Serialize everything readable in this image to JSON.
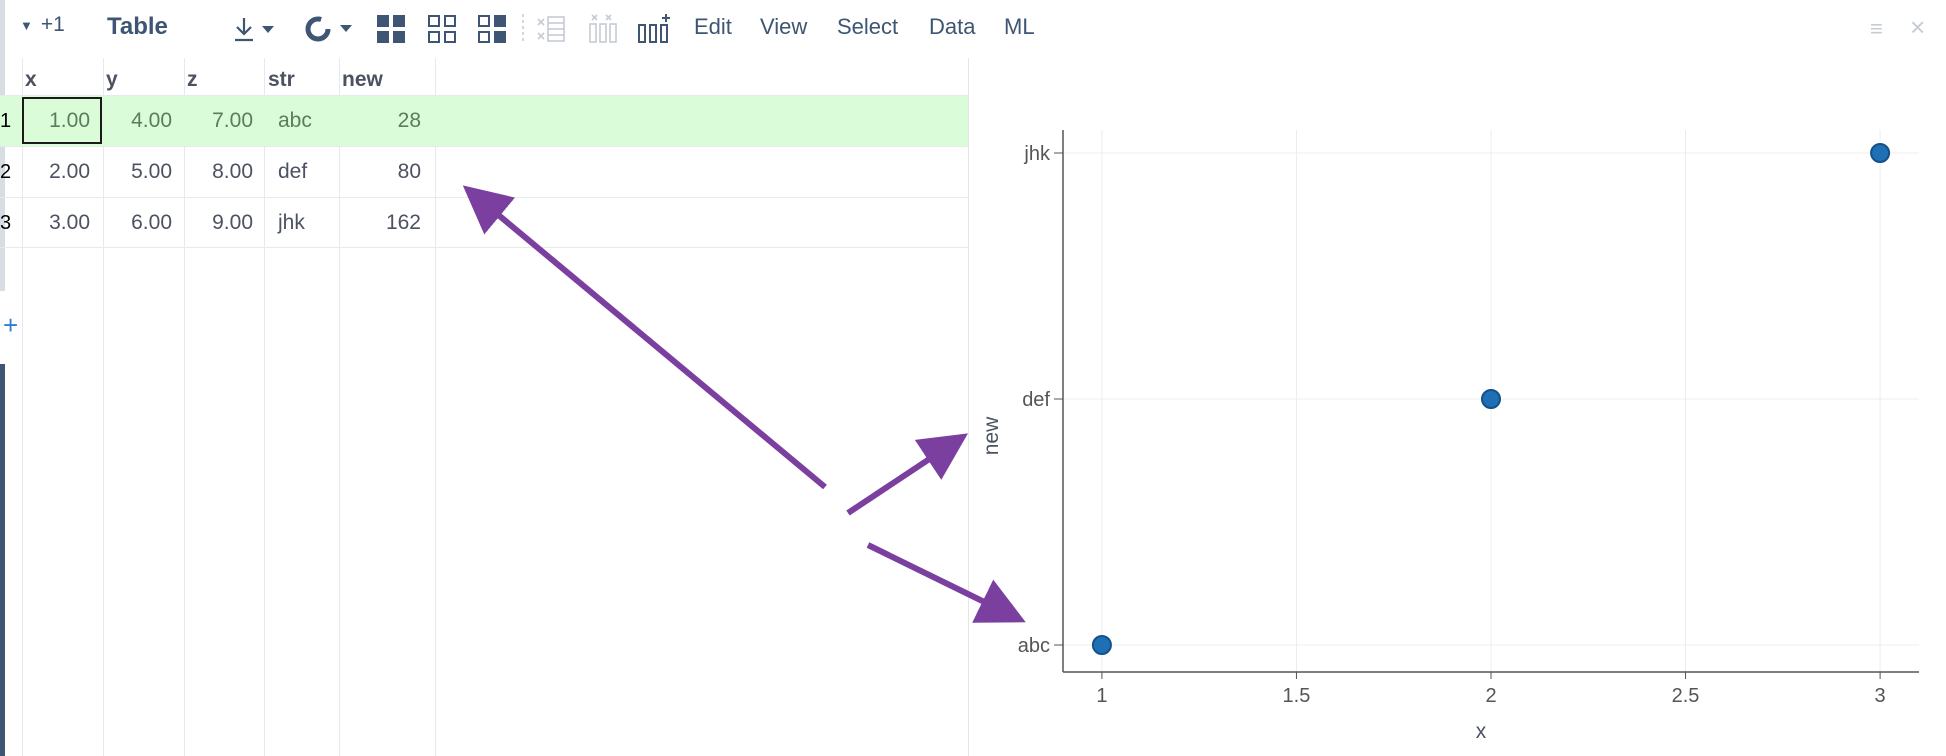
{
  "toolbar": {
    "count_label": "+1",
    "title": "Table",
    "menus": [
      "Edit",
      "View",
      "Select",
      "Data",
      "ML"
    ]
  },
  "table": {
    "columns": [
      "x",
      "y",
      "z",
      "str",
      "new"
    ],
    "rows": [
      {
        "num": "1",
        "x": "1.00",
        "y": "4.00",
        "z": "7.00",
        "str": "abc",
        "new": "28"
      },
      {
        "num": "2",
        "x": "2.00",
        "y": "5.00",
        "z": "8.00",
        "str": "def",
        "new": "80"
      },
      {
        "num": "3",
        "x": "3.00",
        "y": "6.00",
        "z": "9.00",
        "str": "jhk",
        "new": "162"
      }
    ],
    "add_row_icon": "plus-icon"
  },
  "chart_data": {
    "type": "scatter",
    "xlabel": "x",
    "ylabel": "new",
    "x_ticks": [
      "1",
      "1.5",
      "2",
      "2.5",
      "3"
    ],
    "y_categories": [
      "abc",
      "def",
      "jhk"
    ],
    "xlim": [
      0.9,
      3.1
    ],
    "points": [
      {
        "x": 1,
        "y": "abc"
      },
      {
        "x": 2,
        "y": "def"
      },
      {
        "x": 3,
        "y": "jhk"
      }
    ],
    "marker_color": "#1f6fb5",
    "grid": true
  },
  "colors": {
    "accent": "#3e5573",
    "selected_row": "#dbfcd8",
    "arrow": "#7b3fa0"
  }
}
